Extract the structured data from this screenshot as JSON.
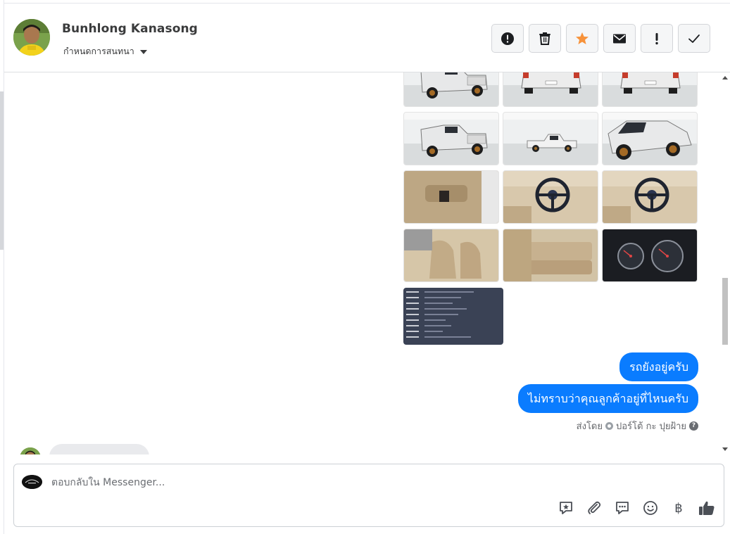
{
  "header": {
    "contact_name": "Bunhlong Kanasong",
    "assign_label": "กำหนดการสนทนา",
    "actions": [
      {
        "icon": "alert-circle-icon",
        "name": "mark-spam-button"
      },
      {
        "icon": "trash-icon",
        "name": "delete-button"
      },
      {
        "icon": "star-icon",
        "name": "star-button"
      },
      {
        "icon": "envelope-icon",
        "name": "mark-unread-button"
      },
      {
        "icon": "exclamation-icon",
        "name": "follow-up-button"
      },
      {
        "icon": "check-icon",
        "name": "mark-done-button"
      }
    ]
  },
  "conversation": {
    "photos": [
      {
        "subject": "truck-rear-angle"
      },
      {
        "subject": "truck-rear"
      },
      {
        "subject": "truck-rear"
      },
      {
        "subject": "truck-rear-angle"
      },
      {
        "subject": "truck-side"
      },
      {
        "subject": "truck-front-angle"
      },
      {
        "subject": "door-panel"
      },
      {
        "subject": "steering-wheel"
      },
      {
        "subject": "steering-wheel"
      },
      {
        "subject": "front-seats"
      },
      {
        "subject": "rear-seat"
      },
      {
        "subject": "gauge-cluster"
      }
    ],
    "messages": [
      {
        "text": "รถยังอยู่ครับ",
        "direction": "outgoing"
      },
      {
        "text": "ไม่ทราบว่าคุณลูกค้าอยู่ที่ไหนครับ",
        "direction": "outgoing"
      }
    ],
    "sent_by_prefix": "ส่งโดย",
    "sent_by_name": "ปอร์โต้ กะ ปุยฝ้าย",
    "help_glyph": "?"
  },
  "composer": {
    "placeholder": "ตอบกลับใน Messenger...",
    "tools": [
      "saved-reply-icon",
      "attachment-icon",
      "chat-icon",
      "emoji-icon",
      "baht-icon",
      "thumbs-up-icon"
    ],
    "baht_glyph": "฿"
  },
  "colors": {
    "accent": "#0a7cff",
    "star": "#f7923a",
    "icon": "#4b4f56"
  }
}
